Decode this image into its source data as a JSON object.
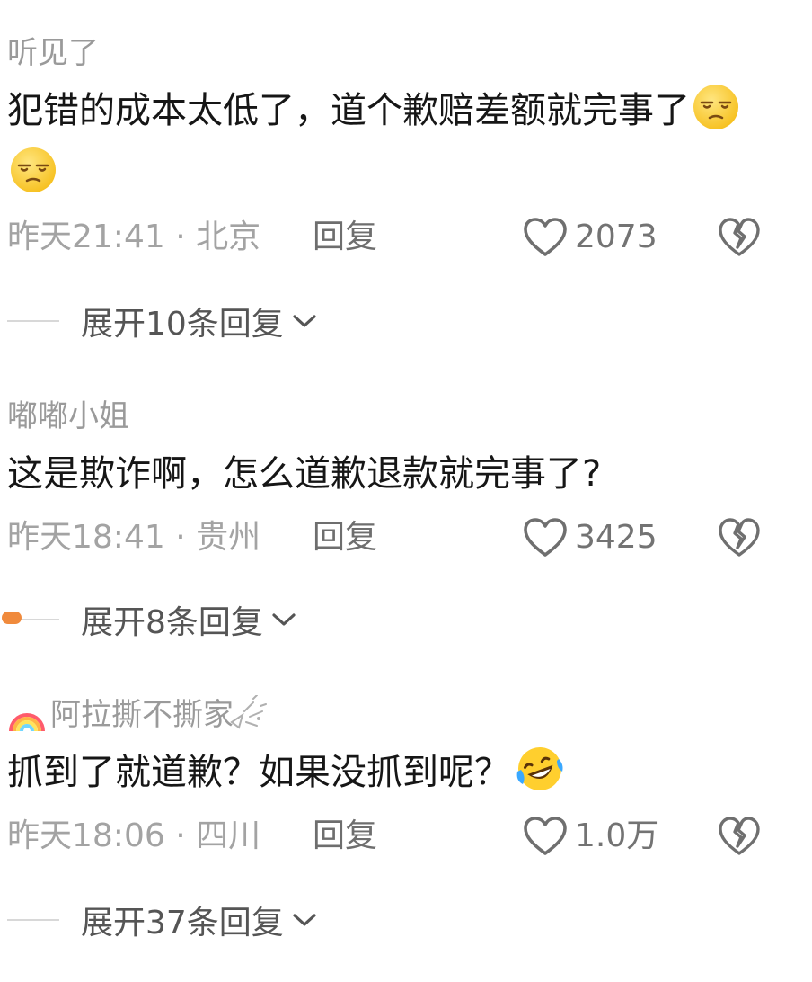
{
  "comments": [
    {
      "username": "听见了",
      "text": "犯错的成本太低了，道个歉赔差额就完事了",
      "emojis": [
        "smirk-face-icon",
        "smirk-face-icon"
      ],
      "time_location": "昨天21:41 · 北京",
      "reply_label": "回复",
      "likes": "2073",
      "expand_label": "展开10条回复"
    },
    {
      "username": "嘟嘟小姐",
      "text": "这是欺诈啊，怎么道歉退款就完事了?",
      "emojis": [],
      "time_location": "昨天18:41 · 贵州",
      "reply_label": "回复",
      "likes": "3425",
      "expand_label": "展开8条回复"
    },
    {
      "username": "阿拉撕不撕家",
      "username_decorations": [
        "rainbow-icon",
        "sparkle-icon"
      ],
      "text": "抓到了就道歉？如果没抓到呢？",
      "emojis": [
        "laughing-tears-icon"
      ],
      "time_location": "昨天18:06 · 四川",
      "reply_label": "回复",
      "likes": "1.0万",
      "expand_label": "展开37条回复"
    }
  ],
  "colors": {
    "text": "#161616",
    "muted": "#9a9a9a",
    "emoji_yellow": "#ffd43b",
    "accent_orange": "#f08a3c"
  }
}
